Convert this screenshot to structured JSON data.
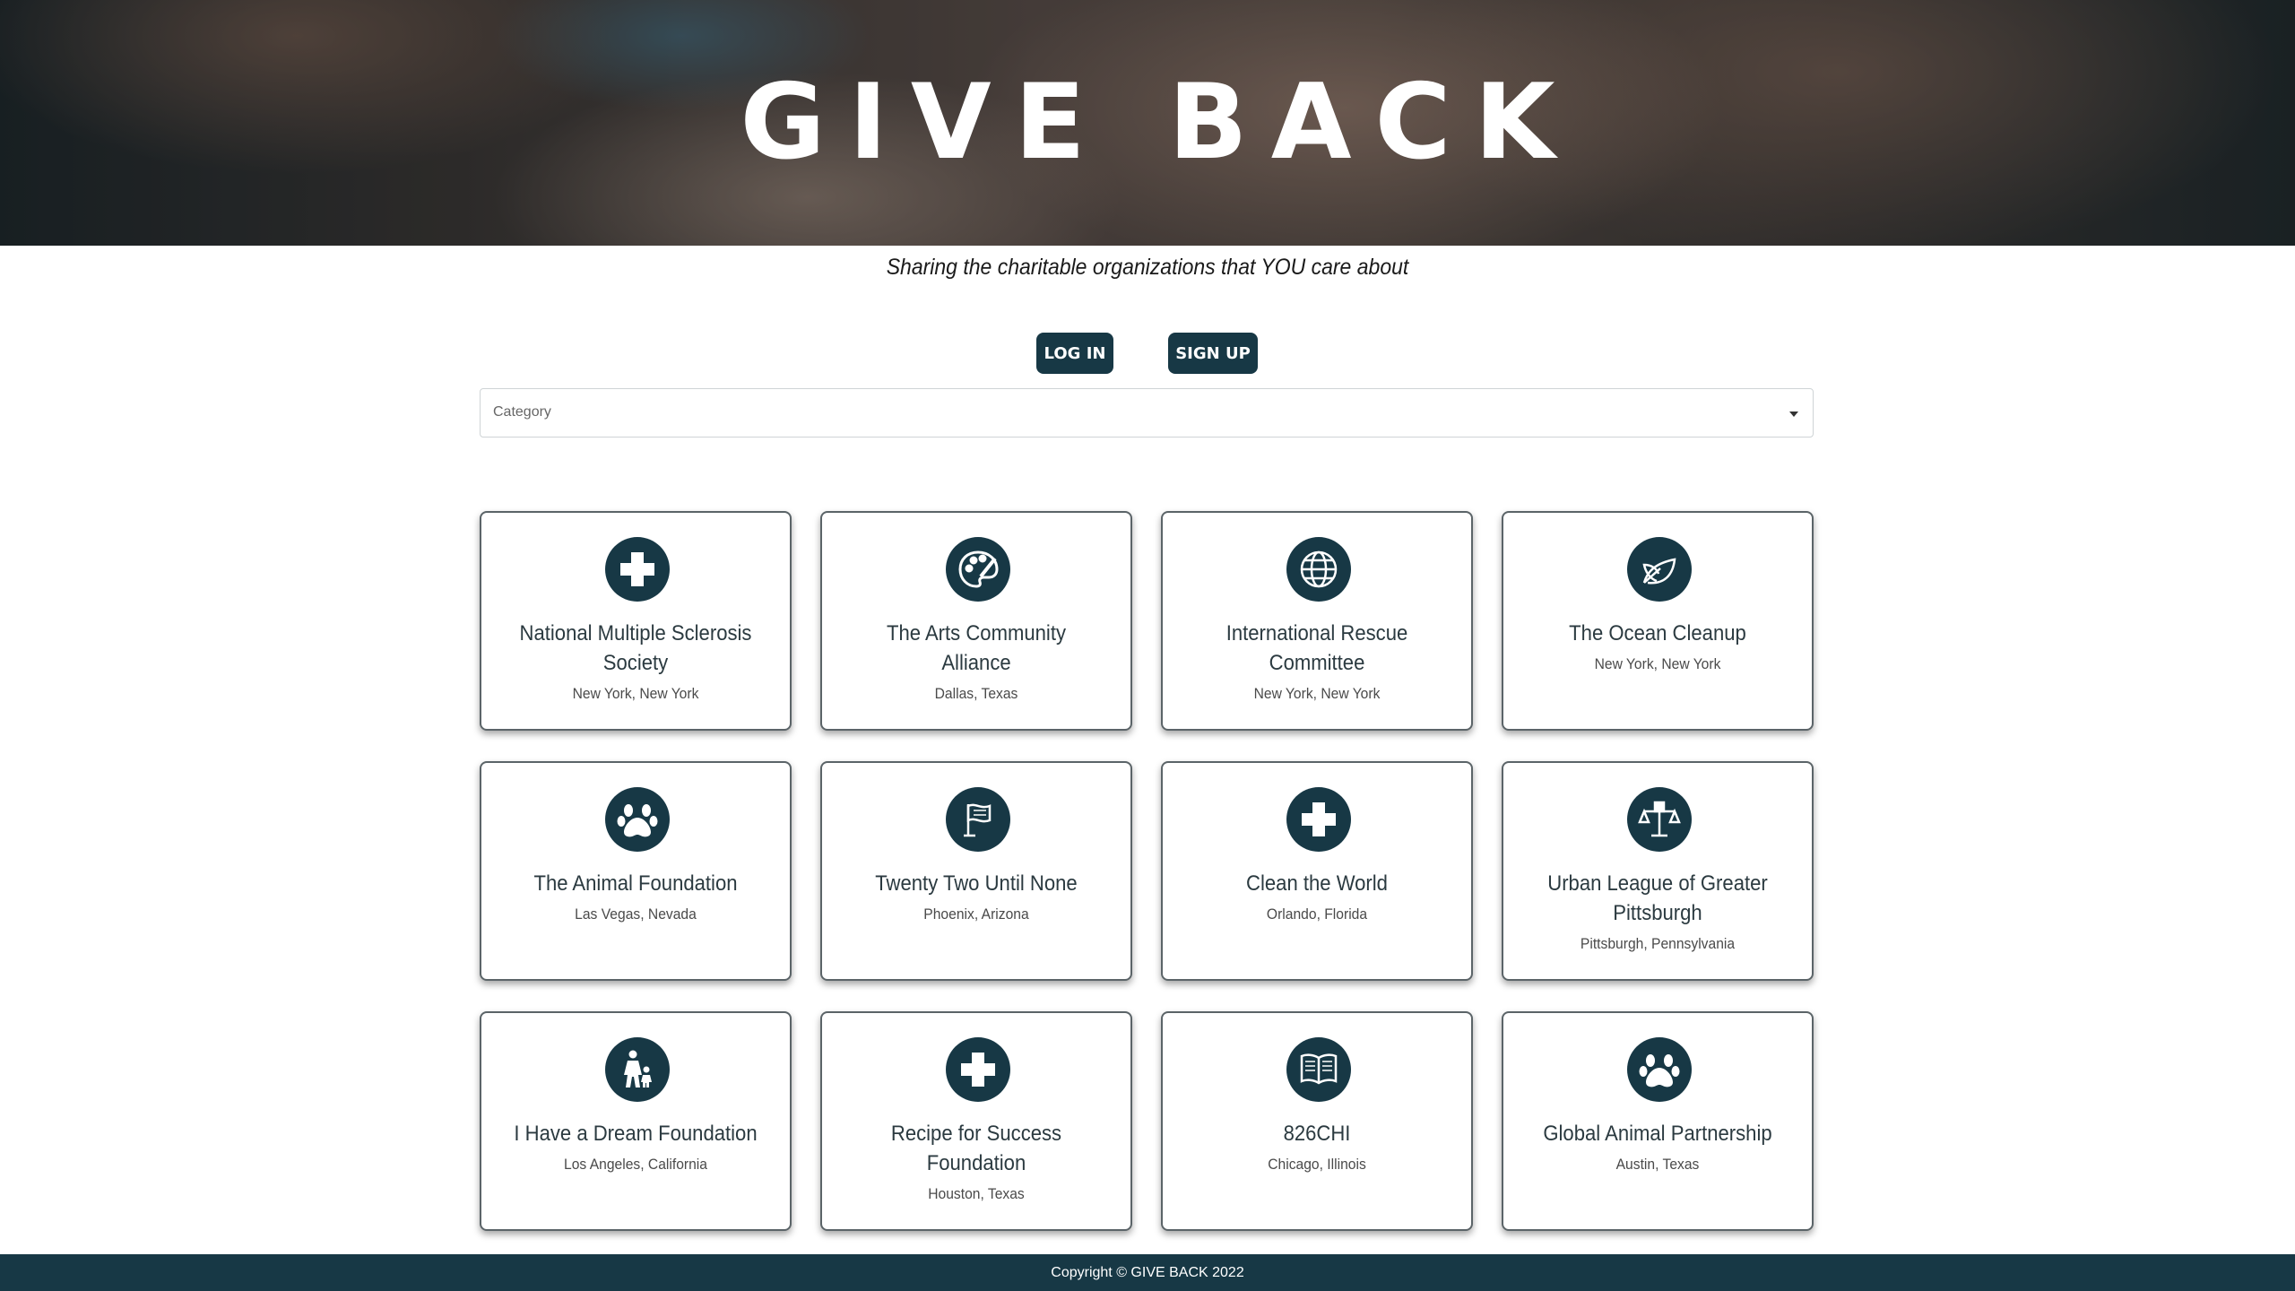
{
  "hero": {
    "title": "GIVE BACK"
  },
  "tagline": "Sharing the charitable organizations that YOU care about",
  "auth": {
    "login_label": "LOG IN",
    "signup_label": "SIGN UP"
  },
  "filter": {
    "placeholder": "Category"
  },
  "colors": {
    "primary": "#173845",
    "card_border": "#5b6468"
  },
  "organizations": [
    {
      "name": "National Multiple Sclerosis Society",
      "location": "New York, New York",
      "icon": "medical-cross-icon"
    },
    {
      "name": "The Arts Community Alliance",
      "location": "Dallas, Texas",
      "icon": "paint-palette-icon"
    },
    {
      "name": "International Rescue Committee",
      "location": "New York, New York",
      "icon": "globe-icon"
    },
    {
      "name": "The Ocean Cleanup",
      "location": "New York, New York",
      "icon": "leaf-icon"
    },
    {
      "name": "The Animal Foundation",
      "location": "Las Vegas, Nevada",
      "icon": "paw-icon"
    },
    {
      "name": "Twenty Two Until None",
      "location": "Phoenix, Arizona",
      "icon": "flag-icon"
    },
    {
      "name": "Clean the World",
      "location": "Orlando, Florida",
      "icon": "medical-cross-icon"
    },
    {
      "name": "Urban League of Greater Pittsburgh",
      "location": "Pittsburgh, Pennsylvania",
      "icon": "justice-scale-icon"
    },
    {
      "name": "I Have a Dream Foundation",
      "location": "Los Angeles, California",
      "icon": "parent-child-icon"
    },
    {
      "name": "Recipe for Success Foundation",
      "location": "Houston, Texas",
      "icon": "medical-cross-icon"
    },
    {
      "name": "826CHI",
      "location": "Chicago, Illinois",
      "icon": "book-icon"
    },
    {
      "name": "Global Animal Partnership",
      "location": "Austin, Texas",
      "icon": "paw-icon"
    }
  ],
  "footer": {
    "copyright": "Copyright © GIVE BACK 2022"
  }
}
